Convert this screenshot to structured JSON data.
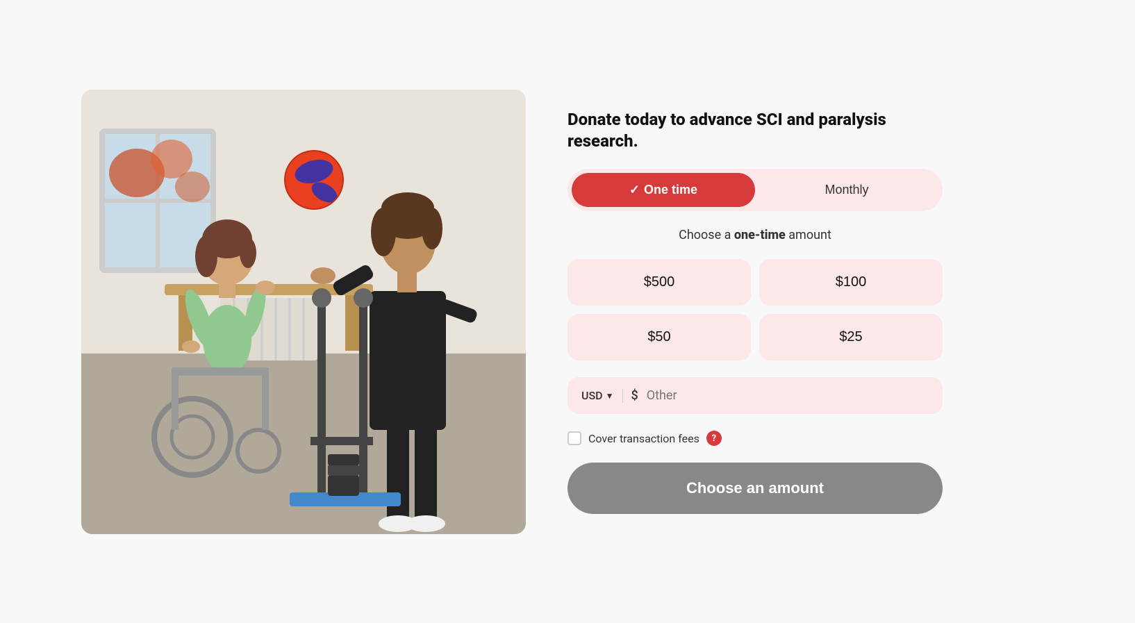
{
  "page": {
    "title": "Donate today to advance SCI and paralysis research."
  },
  "toggle": {
    "one_time_label": "One time",
    "monthly_label": "Monthly",
    "active": "one_time"
  },
  "form": {
    "subtitle_prefix": "Choose a ",
    "subtitle_bold": "one-time",
    "subtitle_suffix": " amount",
    "amounts": [
      {
        "id": "amount-500",
        "label": "$500"
      },
      {
        "id": "amount-100",
        "label": "$100"
      },
      {
        "id": "amount-50",
        "label": "$50"
      },
      {
        "id": "amount-25",
        "label": "$25"
      }
    ],
    "currency_label": "USD",
    "dollar_sign": "$",
    "other_placeholder": "Other",
    "checkbox_label": "Cover transaction fees",
    "info_icon_label": "?",
    "cta_label": "Choose an amount"
  },
  "icons": {
    "checkmark": "✓",
    "chevron_down": "▼"
  }
}
